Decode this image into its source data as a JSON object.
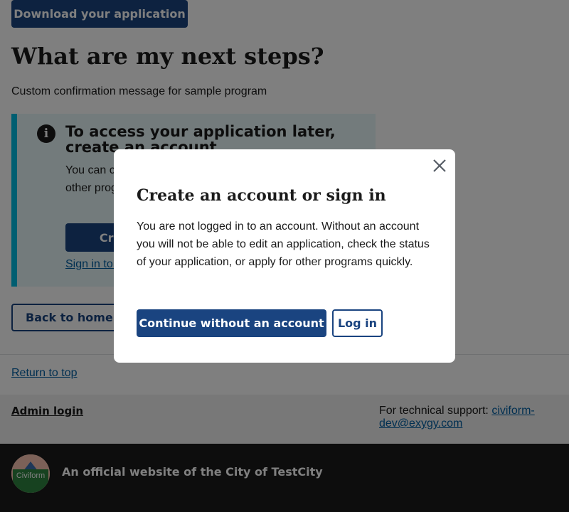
{
  "page": {
    "download_label": "Download your application",
    "heading": "What are my next steps?",
    "confirmation_message": "Custom confirmation message for sample program",
    "alert": {
      "title": "To access your application later, create an account",
      "text": "You can check the status of your application and apply to other programs more quickly when you have an account.",
      "create_account_label": "Create an account",
      "sign_in_label": "Sign in to an existing account"
    },
    "back_home_label": "Back to homepage"
  },
  "footer": {
    "return_top_label": "Return to top",
    "admin_login_label": "Admin login",
    "support_prefix": "For technical support:",
    "support_email": "civiform-dev@exygy.com",
    "logo_text": "Civiform",
    "official_text": "An official website of the City of TestCity"
  },
  "modal": {
    "title": "Create an account or sign in",
    "body": "You are not logged in to an account. Without an account you will not be able to edit an application, check the status of your application, or apply for other programs quickly.",
    "continue_label": "Continue without an account",
    "login_label": "Log in",
    "close_icon": "close-icon"
  },
  "colors": {
    "primary": "#1a4480",
    "link": "#005ea2",
    "alert_bg": "#e7f6f8",
    "alert_border": "#00bde3",
    "footer_dark": "#1b1b1b"
  }
}
